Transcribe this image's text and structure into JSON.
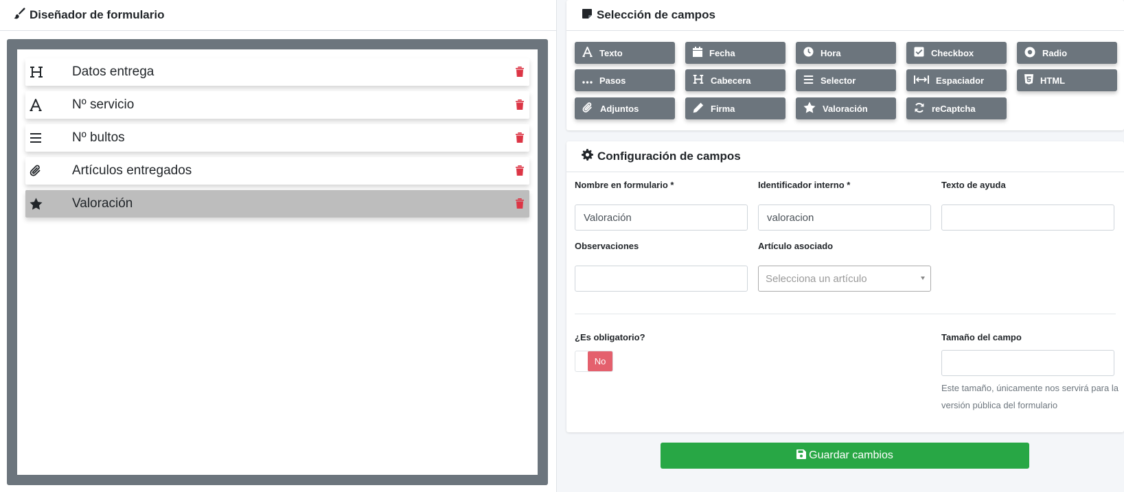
{
  "designer": {
    "title": "Diseñador de formulario",
    "fields": [
      {
        "icon": "heading-icon",
        "label": "Datos entrega",
        "selected": false
      },
      {
        "icon": "text-icon",
        "label": "Nº servicio",
        "selected": false
      },
      {
        "icon": "list-icon",
        "label": "Nº bultos",
        "selected": false
      },
      {
        "icon": "paperclip-icon",
        "label": "Artículos entregados",
        "selected": false
      },
      {
        "icon": "star-icon",
        "label": "Valoración",
        "selected": true
      }
    ]
  },
  "selection": {
    "title": "Selección de campos",
    "buttons": [
      {
        "label": "Texto",
        "icon": "text-icon"
      },
      {
        "label": "Fecha",
        "icon": "calendar-icon"
      },
      {
        "label": "Hora",
        "icon": "clock-icon"
      },
      {
        "label": "Checkbox",
        "icon": "checkbox-icon"
      },
      {
        "label": "Radio",
        "icon": "radio-icon"
      },
      {
        "label": "Pasos",
        "icon": "ellipsis-icon"
      },
      {
        "label": "Cabecera",
        "icon": "heading-icon"
      },
      {
        "label": "Selector",
        "icon": "list-icon"
      },
      {
        "label": "Espaciador",
        "icon": "spacer-icon"
      },
      {
        "label": "HTML",
        "icon": "html5-icon"
      },
      {
        "label": "Adjuntos",
        "icon": "paperclip-icon"
      },
      {
        "label": "Firma",
        "icon": "pencil-icon"
      },
      {
        "label": "Valoración",
        "icon": "star-icon"
      },
      {
        "label": "reCaptcha",
        "icon": "refresh-icon"
      }
    ]
  },
  "config": {
    "title": "Configuración de campos",
    "name_label": "Nombre en formulario *",
    "name_value": "Valoración",
    "id_label": "Identificador interno *",
    "id_value": "valoracion",
    "help_label": "Texto de ayuda",
    "help_value": "",
    "obs_label": "Observaciones",
    "obs_value": "",
    "article_label": "Artículo asociado",
    "article_placeholder": "Selecciona un artículo",
    "required_label": "¿Es obligatorio?",
    "required_value": "No",
    "size_label": "Tamaño del campo",
    "size_value": "",
    "size_help": "Este tamaño, únicamente nos servirá para la versión pública del formulario"
  },
  "actions": {
    "save_label": "Guardar cambios"
  },
  "colors": {
    "button_gray": "#6c757d",
    "danger": "#dc3545",
    "success": "#28a745",
    "toggle_off": "#e4606d"
  }
}
